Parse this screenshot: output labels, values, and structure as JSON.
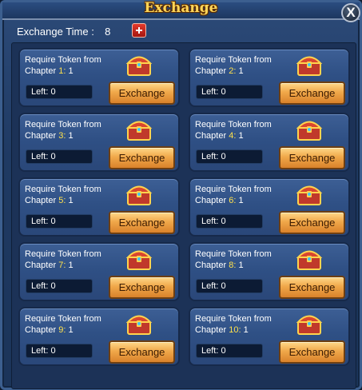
{
  "window": {
    "title": "Exchange",
    "close_symbol": "X"
  },
  "topbar": {
    "exchange_time_label": "Exchange Time :",
    "exchange_time_value": "8"
  },
  "cards": [
    {
      "req_line1": "Require Token from",
      "chapter_label": "Chapter",
      "chapter_num": "1:",
      "token_count": "1",
      "left_label": "Left:",
      "left_value": "0",
      "button_label": "Exchange"
    },
    {
      "req_line1": "Require Token from",
      "chapter_label": "Chapter",
      "chapter_num": "2:",
      "token_count": "1",
      "left_label": "Left:",
      "left_value": "0",
      "button_label": "Exchange"
    },
    {
      "req_line1": "Require Token from",
      "chapter_label": "Chapter",
      "chapter_num": "3:",
      "token_count": "1",
      "left_label": "Left:",
      "left_value": "0",
      "button_label": "Exchange"
    },
    {
      "req_line1": "Require Token from",
      "chapter_label": "Chapter",
      "chapter_num": "4:",
      "token_count": "1",
      "left_label": "Left:",
      "left_value": "0",
      "button_label": "Exchange"
    },
    {
      "req_line1": "Require Token from",
      "chapter_label": "Chapter",
      "chapter_num": "5:",
      "token_count": "1",
      "left_label": "Left:",
      "left_value": "0",
      "button_label": "Exchange"
    },
    {
      "req_line1": "Require Token from",
      "chapter_label": "Chapter",
      "chapter_num": "6:",
      "token_count": "1",
      "left_label": "Left:",
      "left_value": "0",
      "button_label": "Exchange"
    },
    {
      "req_line1": "Require Token from",
      "chapter_label": "Chapter",
      "chapter_num": "7:",
      "token_count": "1",
      "left_label": "Left:",
      "left_value": "0",
      "button_label": "Exchange"
    },
    {
      "req_line1": "Require Token from",
      "chapter_label": "Chapter",
      "chapter_num": "8:",
      "token_count": "1",
      "left_label": "Left:",
      "left_value": "0",
      "button_label": "Exchange"
    },
    {
      "req_line1": "Require Token from",
      "chapter_label": "Chapter",
      "chapter_num": "9:",
      "token_count": "1",
      "left_label": "Left:",
      "left_value": "0",
      "button_label": "Exchange"
    },
    {
      "req_line1": "Require Token from",
      "chapter_label": "Chapter",
      "chapter_num": "10:",
      "token_count": "1",
      "left_label": "Left:",
      "left_value": "0",
      "button_label": "Exchange"
    }
  ],
  "icons": {
    "chest": "treasure-chest-icon",
    "add": "plus-icon",
    "close": "close-icon"
  },
  "colors": {
    "title": "#ffd65a",
    "chapter_number": "#ffe14b",
    "button": "#f0a84a"
  }
}
